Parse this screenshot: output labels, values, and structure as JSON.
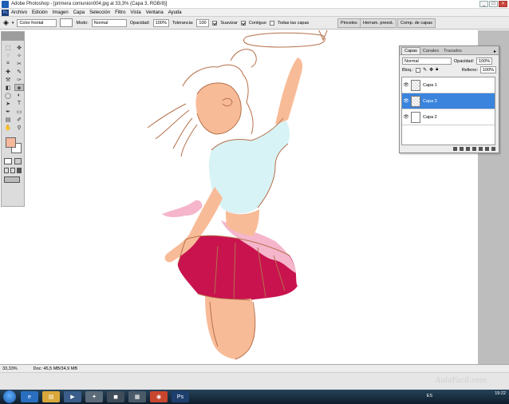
{
  "window": {
    "title": "Adobe Photoshop - [primera comunion004.jpg al 33,3% (Capa 3, RGB/8)]",
    "min_glyph": "_",
    "max_glyph": "□",
    "close_glyph": "×"
  },
  "menu": {
    "items": [
      "Archivo",
      "Edición",
      "Imagen",
      "Capa",
      "Selección",
      "Filtro",
      "Vista",
      "Ventana",
      "Ayuda"
    ]
  },
  "options": {
    "color_mode": "Color frontal",
    "modo_label": "Modo:",
    "modo_value": "Normal",
    "opacidad_label": "Opacidad:",
    "opacidad_value": "100%",
    "tolerancia_label": "Tolerancia:",
    "tolerancia_value": "100",
    "suavizar_label": "Suavizar",
    "contiguo_label": "Contiguo",
    "todas_capas_label": "Todas las capas",
    "wells": [
      "Pinceles",
      "Herram. preest.",
      "Comp. de capas"
    ]
  },
  "tools": {
    "icons": [
      "marquee-icon",
      "move-icon",
      "lasso-icon",
      "magic-wand-icon",
      "crop-icon",
      "slice-icon",
      "healing-icon",
      "brush-icon",
      "stamp-icon",
      "history-brush-icon",
      "eraser-icon",
      "paint-bucket-icon",
      "blur-icon",
      "dodge-icon",
      "path-select-icon",
      "type-icon",
      "pen-icon",
      "shape-icon",
      "notes-icon",
      "eyedropper-icon",
      "hand-icon",
      "zoom-icon"
    ],
    "glyphs": [
      "⬚",
      "✥",
      "◌",
      "✧",
      "⌗",
      "✂",
      "✚",
      "✎",
      "⚒",
      "✑",
      "◧",
      "◈",
      "◯",
      "◐",
      "➤",
      "T",
      "✒",
      "▭",
      "▤",
      "✐",
      "✋",
      "⚲"
    ],
    "foreground_color": "#f7b89c",
    "background_color": "#ffffff"
  },
  "layers": {
    "tabs": [
      "Capas",
      "Canales",
      "Trazados"
    ],
    "blend_mode": "Normal",
    "opacidad_label": "Opacidad:",
    "opacidad_value": "100%",
    "bloq_label": "Bloq.:",
    "relleno_label": "Relleno:",
    "relleno_value": "100%",
    "items": [
      {
        "name": "Capa 1",
        "selected": false
      },
      {
        "name": "Capa 3",
        "selected": true
      },
      {
        "name": "Capa 2",
        "selected": false
      }
    ]
  },
  "status": {
    "zoom": "33,33%",
    "doc": "Doc: 45,5 MB/34,9 MB"
  },
  "taskbar": {
    "lang": "ES",
    "time": "19:22",
    "watermark": "AulaFacil.com"
  },
  "colors": {
    "skin": "#f8bb98",
    "shirt": "#d8f3f5",
    "skirt": "#c8134f",
    "petticoat": "#f5b6cc",
    "lineart": "#b5704a",
    "selection": "#3a84dd"
  }
}
